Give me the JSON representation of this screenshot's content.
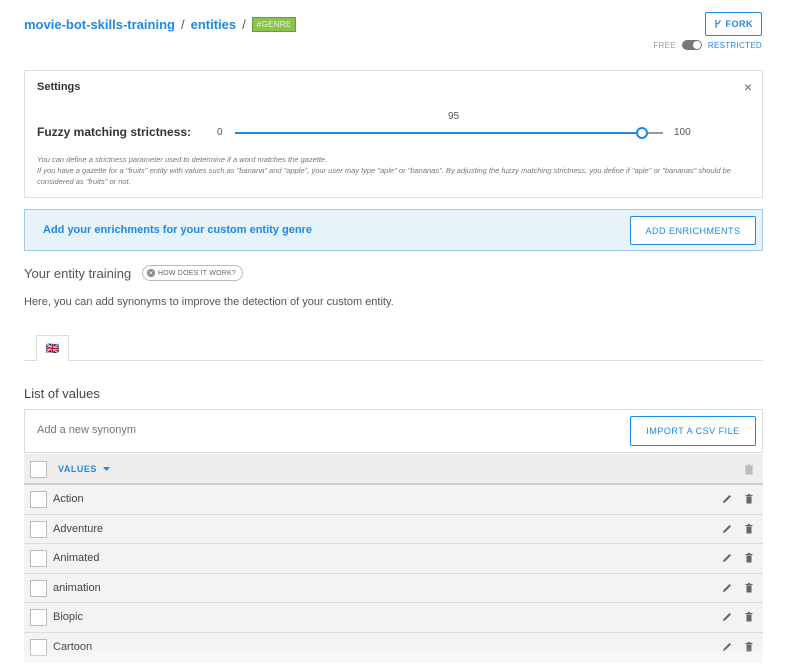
{
  "breadcrumb": {
    "project": "movie-bot-skills-training",
    "separator": "/",
    "section": "entities",
    "entity_tag": "#GENRE"
  },
  "fork_button": {
    "label": "FORK",
    "icon": "fork-icon"
  },
  "access": {
    "free": "FREE",
    "restricted": "RESTRICTED",
    "toggle_state": "restricted"
  },
  "settings": {
    "title": "Settings",
    "close": "×",
    "slider_label": "Fuzzy matching strictness:",
    "min": "0",
    "max": "100",
    "value": "95",
    "value_fraction": 0.95,
    "help_line1": "You can define a strictness parameter used to determine if a word matches the gazette.",
    "help_line2": "If you have a gazette for a \"fruits\" entity with values such as \"banana\" and \"apple\", your user may type \"aple\" or \"bananas\". By adjusting the fuzzy matching strictness, you define if \"aple\" or \"bananas\" should be considered as \"fruits\" or not."
  },
  "enrichments": {
    "text": "Add your enrichments for your custom entity genre",
    "button": "ADD ENRICHMENTS"
  },
  "training": {
    "title": "Your entity training",
    "how_badge": "HOW DOES IT WORK?",
    "description": "Here, you can add synonyms to improve the detection of your custom entity."
  },
  "language_tab": {
    "flag": "🇬🇧"
  },
  "list": {
    "title": "List of values",
    "synonym_placeholder": "Add a new synonym",
    "import_button": "IMPORT A CSV FILE",
    "column_header": "VALUES",
    "rows": [
      "Action",
      "Adventure",
      "Animated",
      "animation",
      "Biopic",
      "Cartoon"
    ]
  },
  "colors": {
    "accent": "#1e88e5",
    "tag": "#8bc34a",
    "enrich_bg": "#e7f3fb"
  }
}
